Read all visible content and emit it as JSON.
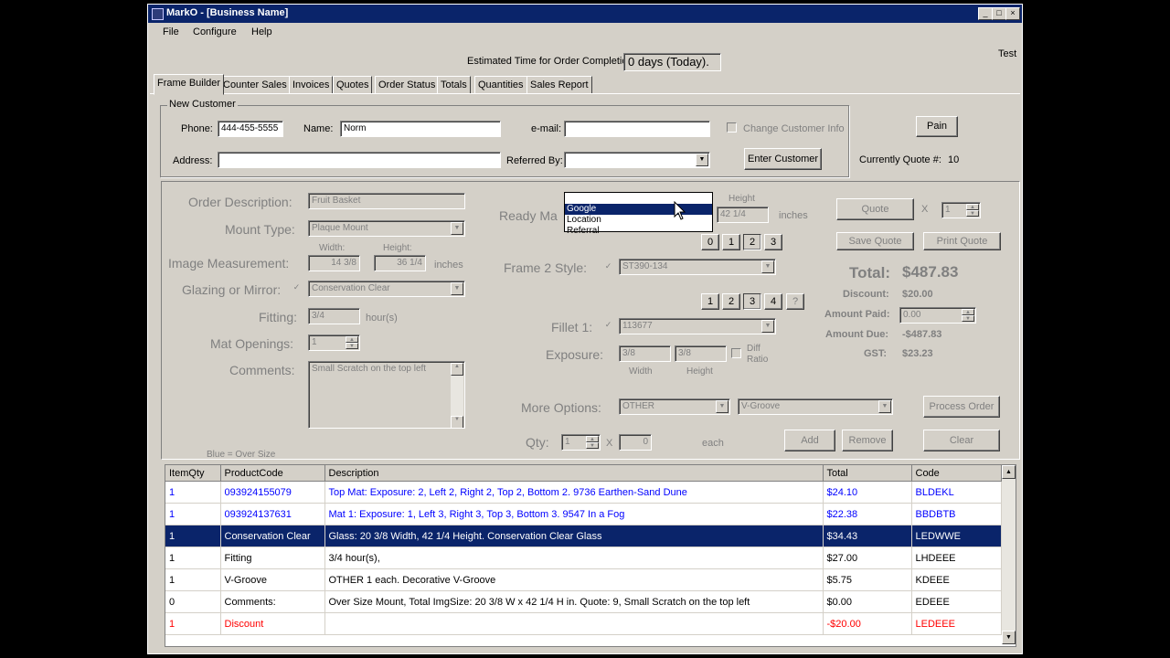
{
  "window": {
    "title": "MarkO - [Business Name]"
  },
  "menu": [
    "File",
    "Configure",
    "Help"
  ],
  "header": {
    "est_label": "Estimated Time for Order Completion:",
    "est_value": "0 days (Today).",
    "user": "Test"
  },
  "tabs": [
    "Frame Builder",
    "Counter Sales",
    "Invoices",
    "Quotes",
    "Order Status",
    "Totals",
    "Quantities",
    "Sales Report"
  ],
  "customer": {
    "group": "New Customer",
    "phone_label": "Phone:",
    "phone": "444-455-5555",
    "name_label": "Name:",
    "name": "Norm",
    "email_label": "e-mail:",
    "email": "",
    "change_info": "Change Customer Info",
    "address_label": "Address:",
    "address": "",
    "referred_label": "Referred By:",
    "referred": "",
    "referred_options": [
      "",
      "Google",
      "Location",
      "Referral"
    ],
    "enter_btn": "Enter Customer",
    "pain_btn": "Pain",
    "quote_label": "Currently Quote #:",
    "quote_num": "10"
  },
  "order": {
    "desc_label": "Order Description:",
    "desc": "Fruit Basket",
    "mount_label": "Mount Type:",
    "mount": "Plaque Mount",
    "img_label": "Image Measurement:",
    "width_label": "Width:",
    "height_label": "Height:",
    "img_w": "14  3/8",
    "img_h": "36  1/4",
    "inches": "inches",
    "glazing_label": "Glazing or Mirror:",
    "glazing": "Conservation Clear",
    "fitting_label": "Fitting:",
    "fitting": "3/4",
    "hours": "hour(s)",
    "mat_label": "Mat Openings:",
    "mat": "1",
    "comments_label": "Comments:",
    "comments": "Small Scratch on the top left",
    "oversize_note": "Blue = Over Size",
    "ready_label": "Ready Ma",
    "ready_h_label": "Height",
    "ready_h": "42  1/4",
    "ready_inches": "inches",
    "frame_nums": [
      "0",
      "1",
      "2",
      "3"
    ],
    "frame2_label": "Frame 2 Style:",
    "frame2": "ST390-134",
    "fillet_nums": [
      "1",
      "2",
      "3",
      "4",
      "?"
    ],
    "fillet_label": "Fillet 1:",
    "fillet": "113677",
    "exposure_label": "Exposure:",
    "exp_w": "3/8",
    "exp_h": "3/8",
    "diff_ratio": "Diff Ratio",
    "exp_w_label": "Width",
    "exp_h_label": "Height",
    "more_label": "More Options:",
    "more1": "OTHER",
    "more2": "V-Groove",
    "qty_label": "Qty:",
    "qty": "1",
    "qty2": "0",
    "each": "each",
    "add_btn": "Add",
    "remove_btn": "Remove",
    "clear_btn": "Clear",
    "process_btn": "Process Order"
  },
  "quote": {
    "quote_btn": "Quote",
    "x": "X",
    "qty": "1",
    "save_btn": "Save Quote",
    "print_btn": "Print Quote",
    "total_label": "Total:",
    "total": "$487.83",
    "discount_label": "Discount:",
    "discount": "$20.00",
    "paid_label": "Amount Paid:",
    "paid": "0.00",
    "due_label": "Amount Due:",
    "due": "-$487.83",
    "gst_label": "GST:",
    "gst": "$23.23"
  },
  "grid": {
    "headers": [
      "ItemQty",
      "ProductCode",
      "Description",
      "Total",
      "Code"
    ],
    "rows": [
      {
        "qty": "1",
        "code": "093924155079",
        "desc": "Top Mat:   Exposure: 2,  Left 2,  Right 2,  Top 2,  Bottom 2.    9736 Earthen-Sand Dune",
        "total": "$24.10",
        "pcode": "BLDEKL",
        "style": "blue"
      },
      {
        "qty": "1",
        "code": "093924137631",
        "desc": "Mat 1:    Exposure: 1,  Left 3,  Right 3,  Top 3,  Bottom 3.    9547 In a Fog",
        "total": "$22.38",
        "pcode": "BBDBTB",
        "style": "blue"
      },
      {
        "qty": "1",
        "code": "Conservation Clear",
        "desc": "Glass:   20  3/8 Width,  42  1/4 Height.    Conservation Clear Glass",
        "total": "$34.43",
        "pcode": "LEDWWE",
        "style": "sel"
      },
      {
        "qty": "1",
        "code": "Fitting",
        "desc": "3/4 hour(s),",
        "total": "$27.00",
        "pcode": "LHDEEE",
        "style": ""
      },
      {
        "qty": "1",
        "code": "V-Groove",
        "desc": "OTHER    1 each.    Decorative V-Groove",
        "total": "$5.75",
        "pcode": "KDEEE",
        "style": ""
      },
      {
        "qty": "0",
        "code": "Comments:",
        "desc": "Over Size Mount,    Total ImgSize: 20  3/8 W x 42  1/4 H in. Quote: 9, Small Scratch on the top left",
        "total": "$0.00",
        "pcode": "EDEEE",
        "style": ""
      },
      {
        "qty": "1",
        "code": "Discount",
        "desc": "",
        "total": "-$20.00",
        "pcode": "LEDEEE",
        "style": "red"
      }
    ]
  }
}
